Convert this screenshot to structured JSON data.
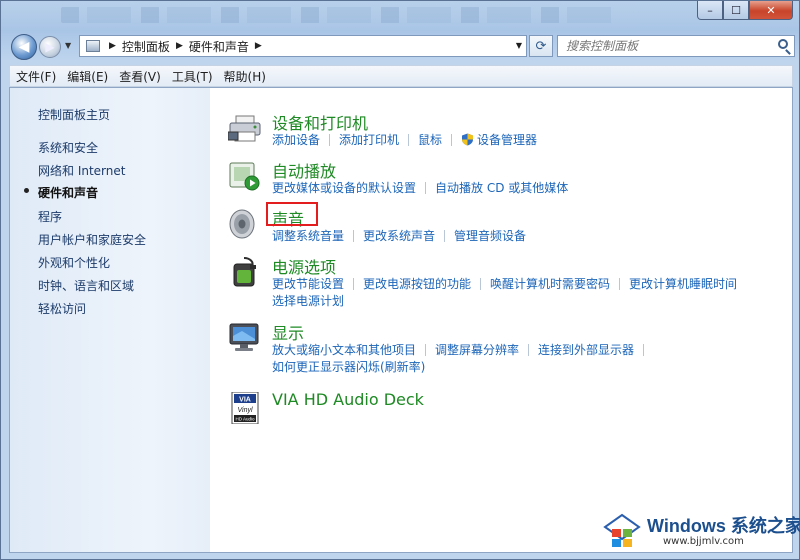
{
  "window": {
    "buttons": {
      "minimize": "–",
      "maximize": "☐",
      "close": "✕"
    }
  },
  "address_bar": {
    "breadcrumbs": [
      "控制面板",
      "硬件和声音"
    ],
    "search_placeholder": "搜索控制面板"
  },
  "menu": [
    "文件(F)",
    "编辑(E)",
    "查看(V)",
    "工具(T)",
    "帮助(H)"
  ],
  "sidebar": {
    "items": [
      {
        "label": "控制面板主页"
      },
      {
        "label": "系统和安全"
      },
      {
        "label": "网络和 Internet"
      },
      {
        "label": "硬件和声音",
        "active": true
      },
      {
        "label": "程序"
      },
      {
        "label": "用户帐户和家庭安全"
      },
      {
        "label": "外观和个性化"
      },
      {
        "label": "时钟、语言和区域"
      },
      {
        "label": "轻松访问"
      }
    ]
  },
  "categories": [
    {
      "title": "设备和打印机",
      "icon": "printer-icon",
      "rows": [
        [
          "添加设备",
          "添加打印机",
          "鼠标",
          "设备管理器"
        ]
      ]
    },
    {
      "title": "自动播放",
      "icon": "autoplay-icon",
      "rows": [
        [
          "更改媒体或设备的默认设置",
          "自动播放 CD 或其他媒体"
        ]
      ]
    },
    {
      "title": "声音",
      "icon": "speaker-icon",
      "highlighted": true,
      "rows": [
        [
          "调整系统音量",
          "更改系统声音",
          "管理音频设备"
        ]
      ]
    },
    {
      "title": "电源选项",
      "icon": "battery-icon",
      "rows": [
        [
          "更改节能设置",
          "更改电源按钮的功能",
          "唤醒计算机时需要密码",
          "更改计算机睡眠时间"
        ],
        [
          "选择电源计划"
        ]
      ]
    },
    {
      "title": "显示",
      "icon": "monitor-icon",
      "rows": [
        [
          "放大或缩小文本和其他项目",
          "调整屏幕分辨率",
          "连接到外部显示器"
        ],
        [
          "如何更正显示器闪烁(刷新率)"
        ]
      ]
    },
    {
      "title": "VIA HD Audio Deck",
      "icon": "via-vinyl-icon",
      "icon_text": [
        "VIA",
        "Vinyl",
        "HD Audio"
      ],
      "rows": []
    }
  ],
  "watermark": {
    "brand": "Windows",
    "brand_cn": "系统之家",
    "url": "www.bjjmlv.com"
  },
  "colors": {
    "link": "#1c65b8",
    "category_title": "#1e8a24",
    "highlight": "#e31d1d"
  }
}
